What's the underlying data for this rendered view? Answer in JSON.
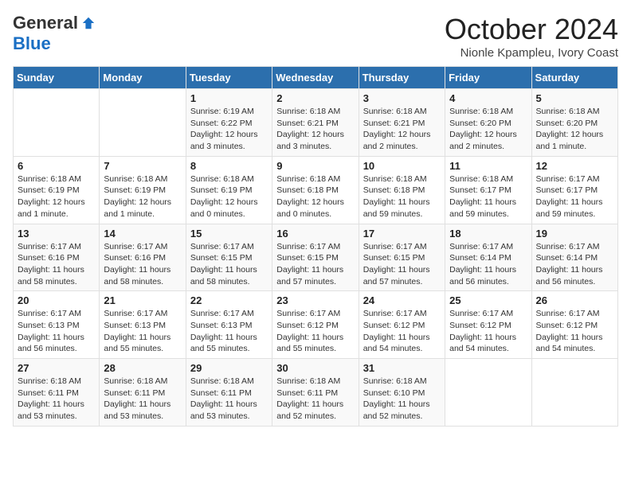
{
  "header": {
    "logo_general": "General",
    "logo_blue": "Blue",
    "month": "October 2024",
    "location": "Nionle Kpampleu, Ivory Coast"
  },
  "weekdays": [
    "Sunday",
    "Monday",
    "Tuesday",
    "Wednesday",
    "Thursday",
    "Friday",
    "Saturday"
  ],
  "weeks": [
    [
      {
        "day": "",
        "info": ""
      },
      {
        "day": "",
        "info": ""
      },
      {
        "day": "1",
        "info": "Sunrise: 6:19 AM\nSunset: 6:22 PM\nDaylight: 12 hours and 3 minutes."
      },
      {
        "day": "2",
        "info": "Sunrise: 6:18 AM\nSunset: 6:21 PM\nDaylight: 12 hours and 3 minutes."
      },
      {
        "day": "3",
        "info": "Sunrise: 6:18 AM\nSunset: 6:21 PM\nDaylight: 12 hours and 2 minutes."
      },
      {
        "day": "4",
        "info": "Sunrise: 6:18 AM\nSunset: 6:20 PM\nDaylight: 12 hours and 2 minutes."
      },
      {
        "day": "5",
        "info": "Sunrise: 6:18 AM\nSunset: 6:20 PM\nDaylight: 12 hours and 1 minute."
      }
    ],
    [
      {
        "day": "6",
        "info": "Sunrise: 6:18 AM\nSunset: 6:19 PM\nDaylight: 12 hours and 1 minute."
      },
      {
        "day": "7",
        "info": "Sunrise: 6:18 AM\nSunset: 6:19 PM\nDaylight: 12 hours and 1 minute."
      },
      {
        "day": "8",
        "info": "Sunrise: 6:18 AM\nSunset: 6:19 PM\nDaylight: 12 hours and 0 minutes."
      },
      {
        "day": "9",
        "info": "Sunrise: 6:18 AM\nSunset: 6:18 PM\nDaylight: 12 hours and 0 minutes."
      },
      {
        "day": "10",
        "info": "Sunrise: 6:18 AM\nSunset: 6:18 PM\nDaylight: 11 hours and 59 minutes."
      },
      {
        "day": "11",
        "info": "Sunrise: 6:18 AM\nSunset: 6:17 PM\nDaylight: 11 hours and 59 minutes."
      },
      {
        "day": "12",
        "info": "Sunrise: 6:17 AM\nSunset: 6:17 PM\nDaylight: 11 hours and 59 minutes."
      }
    ],
    [
      {
        "day": "13",
        "info": "Sunrise: 6:17 AM\nSunset: 6:16 PM\nDaylight: 11 hours and 58 minutes."
      },
      {
        "day": "14",
        "info": "Sunrise: 6:17 AM\nSunset: 6:16 PM\nDaylight: 11 hours and 58 minutes."
      },
      {
        "day": "15",
        "info": "Sunrise: 6:17 AM\nSunset: 6:15 PM\nDaylight: 11 hours and 58 minutes."
      },
      {
        "day": "16",
        "info": "Sunrise: 6:17 AM\nSunset: 6:15 PM\nDaylight: 11 hours and 57 minutes."
      },
      {
        "day": "17",
        "info": "Sunrise: 6:17 AM\nSunset: 6:15 PM\nDaylight: 11 hours and 57 minutes."
      },
      {
        "day": "18",
        "info": "Sunrise: 6:17 AM\nSunset: 6:14 PM\nDaylight: 11 hours and 56 minutes."
      },
      {
        "day": "19",
        "info": "Sunrise: 6:17 AM\nSunset: 6:14 PM\nDaylight: 11 hours and 56 minutes."
      }
    ],
    [
      {
        "day": "20",
        "info": "Sunrise: 6:17 AM\nSunset: 6:13 PM\nDaylight: 11 hours and 56 minutes."
      },
      {
        "day": "21",
        "info": "Sunrise: 6:17 AM\nSunset: 6:13 PM\nDaylight: 11 hours and 55 minutes."
      },
      {
        "day": "22",
        "info": "Sunrise: 6:17 AM\nSunset: 6:13 PM\nDaylight: 11 hours and 55 minutes."
      },
      {
        "day": "23",
        "info": "Sunrise: 6:17 AM\nSunset: 6:12 PM\nDaylight: 11 hours and 55 minutes."
      },
      {
        "day": "24",
        "info": "Sunrise: 6:17 AM\nSunset: 6:12 PM\nDaylight: 11 hours and 54 minutes."
      },
      {
        "day": "25",
        "info": "Sunrise: 6:17 AM\nSunset: 6:12 PM\nDaylight: 11 hours and 54 minutes."
      },
      {
        "day": "26",
        "info": "Sunrise: 6:17 AM\nSunset: 6:12 PM\nDaylight: 11 hours and 54 minutes."
      }
    ],
    [
      {
        "day": "27",
        "info": "Sunrise: 6:18 AM\nSunset: 6:11 PM\nDaylight: 11 hours and 53 minutes."
      },
      {
        "day": "28",
        "info": "Sunrise: 6:18 AM\nSunset: 6:11 PM\nDaylight: 11 hours and 53 minutes."
      },
      {
        "day": "29",
        "info": "Sunrise: 6:18 AM\nSunset: 6:11 PM\nDaylight: 11 hours and 53 minutes."
      },
      {
        "day": "30",
        "info": "Sunrise: 6:18 AM\nSunset: 6:11 PM\nDaylight: 11 hours and 52 minutes."
      },
      {
        "day": "31",
        "info": "Sunrise: 6:18 AM\nSunset: 6:10 PM\nDaylight: 11 hours and 52 minutes."
      },
      {
        "day": "",
        "info": ""
      },
      {
        "day": "",
        "info": ""
      }
    ]
  ]
}
